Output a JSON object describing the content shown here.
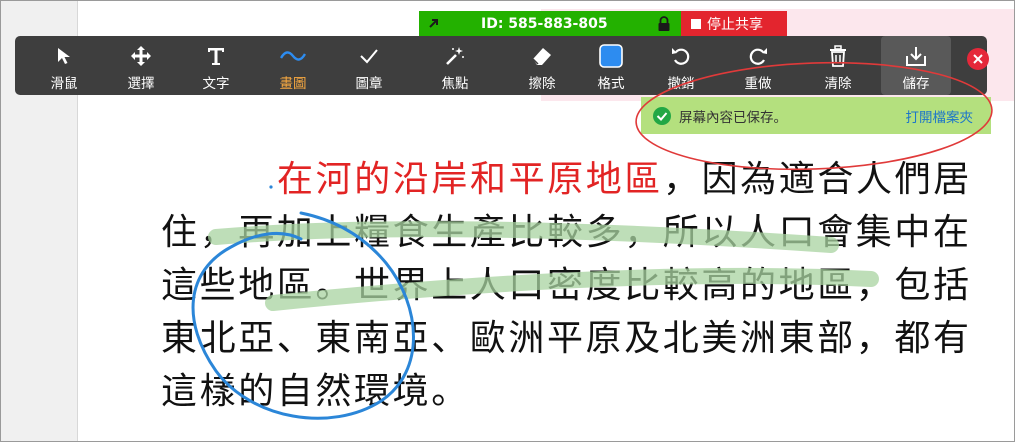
{
  "share_bar": {
    "meeting_id": "ID: 585-883-805",
    "stop_label": "停止共享"
  },
  "toolbar": {
    "tools": [
      {
        "label": "滑鼠",
        "icon": "mouse-pointer-icon"
      },
      {
        "label": "選擇",
        "icon": "move-icon"
      },
      {
        "label": "文字",
        "icon": "text-icon"
      },
      {
        "label": "畫圖",
        "icon": "draw-wave-icon",
        "active": true
      },
      {
        "label": "圖章",
        "icon": "stamp-check-icon"
      },
      {
        "label": "焦點",
        "icon": "spotlight-wand-icon"
      },
      {
        "label": "擦除",
        "icon": "eraser-icon"
      },
      {
        "label": "格式",
        "icon": "format-color-icon"
      },
      {
        "label": "撤銷",
        "icon": "undo-icon"
      },
      {
        "label": "重做",
        "icon": "redo-icon"
      },
      {
        "label": "清除",
        "icon": "trash-icon"
      },
      {
        "label": "儲存",
        "icon": "save-download-icon"
      }
    ]
  },
  "notification": {
    "message": "屏幕內容已保存。",
    "link": "打開檔案夾"
  },
  "document": {
    "line1_red": "在河的沿岸和平原地區",
    "line1_rest": "，因為適合人們居",
    "line2": "住，再加上糧食生產比較多，所以人口會集中在",
    "line3": "這些地區。世界上人口密度比較高的地區，包括",
    "line4": "東北亞、東南亞、歐洲平原及北美洲東部，都有",
    "line5": "這樣的自然環境。"
  },
  "colors": {
    "toolbar_bg": "#3e3e3e",
    "share_green": "#23b100",
    "stop_red": "#e3252e",
    "active_tool": "#f7a840",
    "notice_bg": "#b4e07e",
    "text_red": "#e22424",
    "ink_blue": "#2b86d8",
    "highlighter_green": "#a8d3a0",
    "annotation_red": "#e03a3a"
  }
}
